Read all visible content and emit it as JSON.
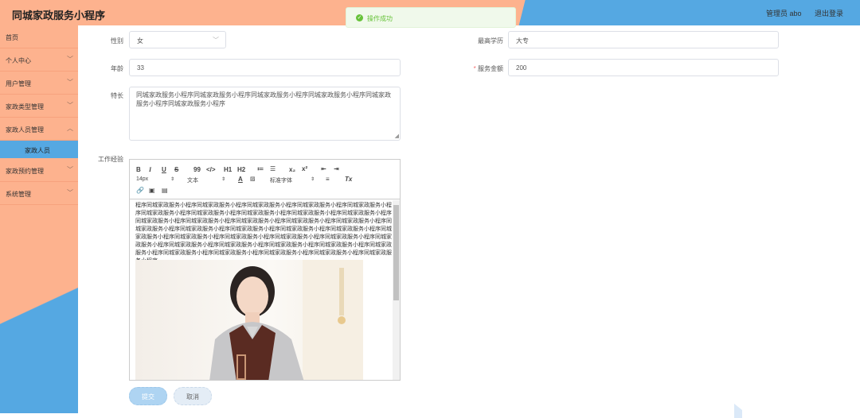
{
  "header": {
    "title": "同城家政服务小程序",
    "user_label": "管理员 abo",
    "logout_label": "退出登录"
  },
  "toast": {
    "message": "操作成功"
  },
  "sidebar": {
    "items": [
      {
        "label": "首页"
      },
      {
        "label": "个人中心"
      },
      {
        "label": "用户管理"
      },
      {
        "label": "家政类型管理"
      },
      {
        "label": "家政人员管理"
      },
      {
        "label": "家政预约管理"
      },
      {
        "label": "系统管理"
      }
    ],
    "active_sub": "家政人员"
  },
  "form": {
    "gender": {
      "label": "性别",
      "value": "女"
    },
    "education": {
      "label": "最高学历",
      "value": "大专"
    },
    "age": {
      "label": "年龄",
      "value": "33"
    },
    "fee": {
      "label": "服务金额",
      "required_mark": "*",
      "value": "200"
    },
    "specialty": {
      "label": "特长",
      "value": "同城家政服务小程序同城家政服务小程序同城家政服务小程序同城家政服务小程序同城家政服务小程序同城家政服务小程序"
    },
    "experience": {
      "label": "工作经验",
      "text": "程序同城家政服务小程序同城家政服务小程序同城家政服务小程序同城家政服务小程序同城家政服务小程序同城家政服务小程序同城家政服务小程序同城家政服务小程序同城家政服务小程序同城家政服务小程序同城家政服务小程序同城家政服务小程序同城家政服务小程序同城家政服务小程序同城家政服务小程序同城家政服务小程序同城家政服务小程序同城家政服务小程序同城家政服务小程序同城家政服务小程序同城家政服务小程序同城家政服务小程序同城家政服务小程序同城家政服务小程序同城家政服务小程序同城家政服务小程序同城家政服务小程序同城家政服务小程序同城家政服务小程序同城家政服务小程序同城家政服务小程序同城家政服务小程序同城家政服务小程序同城家政服务小程序同城家政服务小程序同城家政服务小程序"
    }
  },
  "editor_toolbar": {
    "bold": "B",
    "italic": "I",
    "underline": "U",
    "strike": "S",
    "quote": "99",
    "code": "</>",
    "h1": "H1",
    "h2": "H2",
    "ordered": "≔",
    "bullet": "☰",
    "sub": "x₂",
    "sup": "x²",
    "outdent": "⇤",
    "indent": "⇥",
    "font_size": "14px",
    "text_type": "文本",
    "font_family": "标准字体",
    "align": "≡",
    "clean": "Tx"
  },
  "buttons": {
    "submit": "提交",
    "cancel": "取消"
  },
  "colors": {
    "header_orange": "#fdb28e",
    "header_blue": "#55a8e2",
    "success": "#67c23a"
  }
}
